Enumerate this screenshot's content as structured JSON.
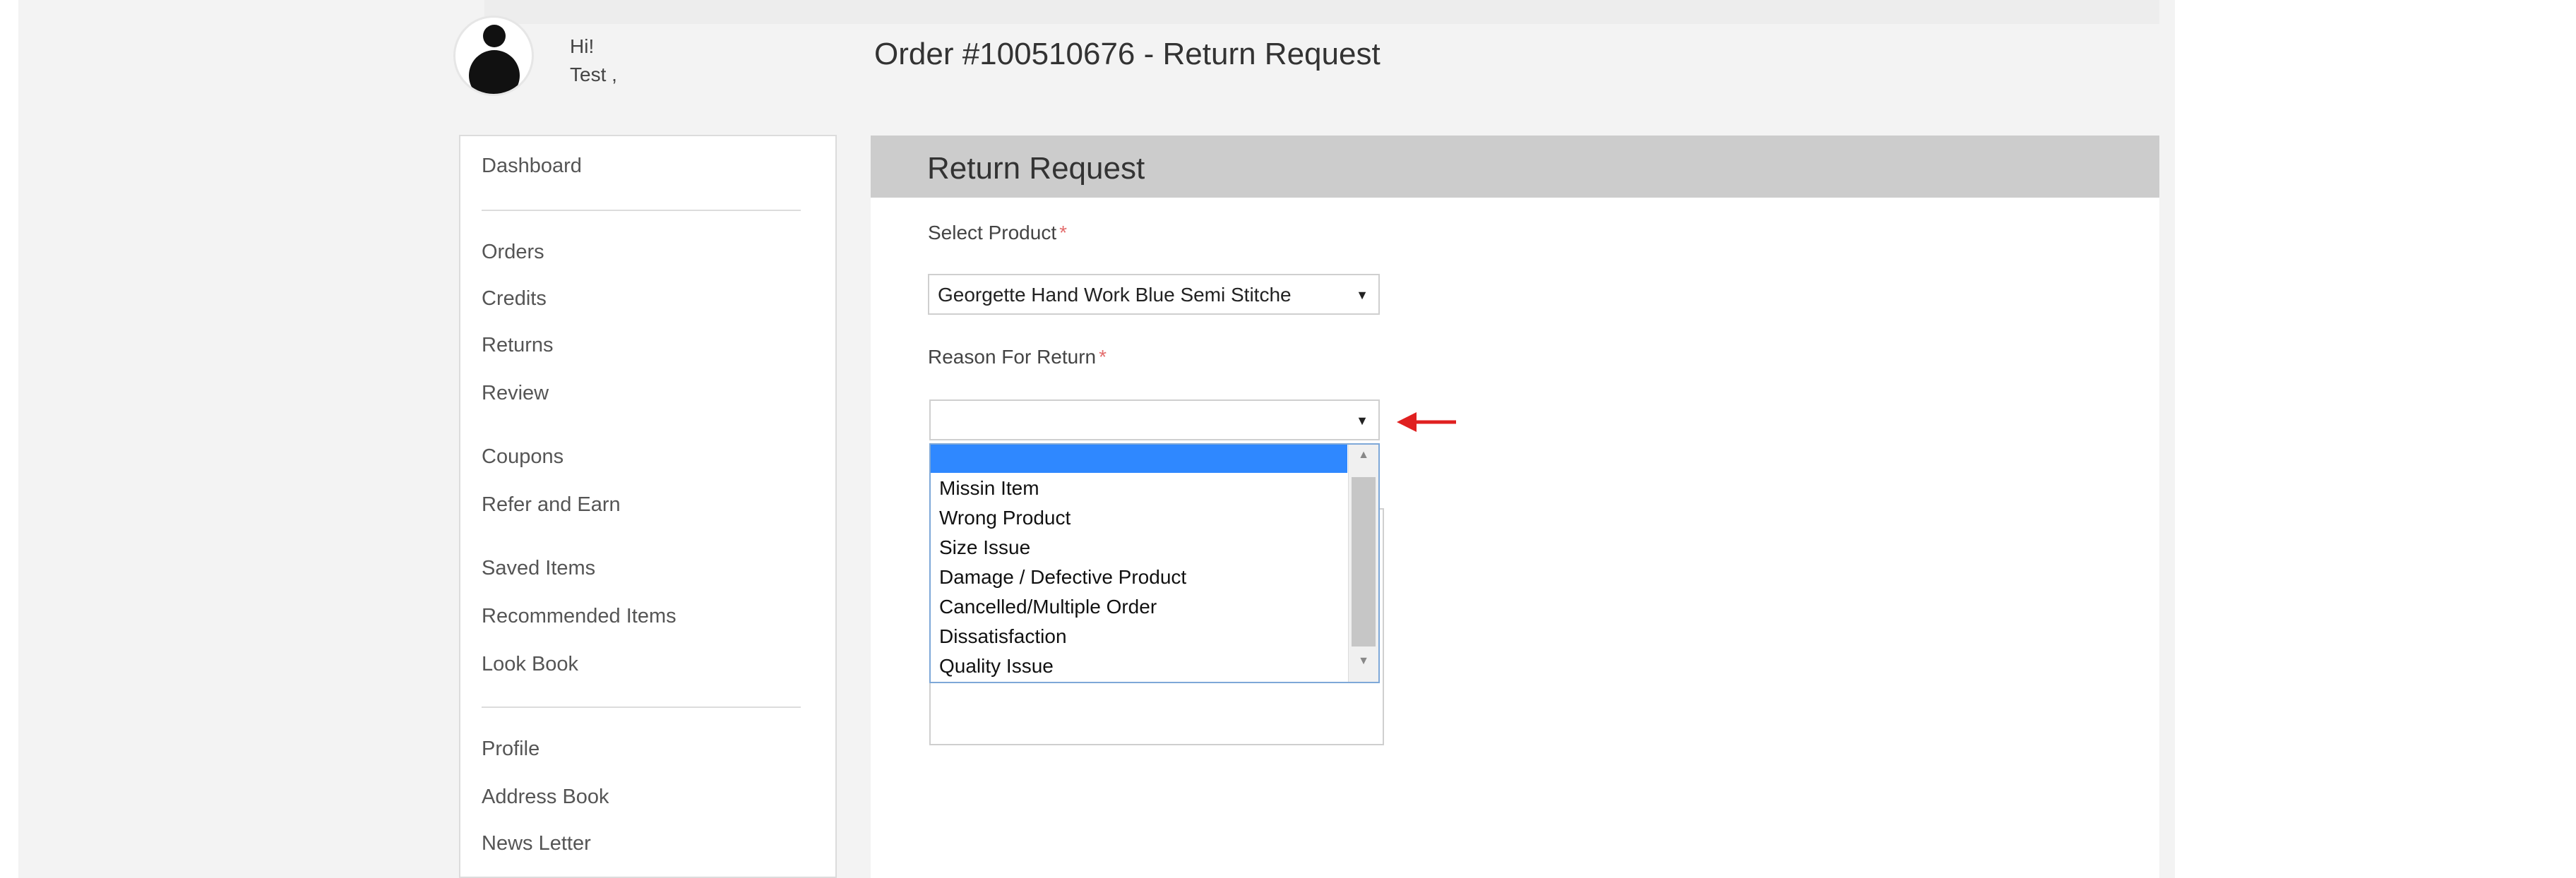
{
  "user": {
    "greeting": "Hi!",
    "name": "Test ,"
  },
  "page_title": "Order #100510676 - Return Request",
  "sidebar": {
    "items": [
      "Dashboard",
      "Orders",
      "Credits",
      "Returns",
      "Review",
      "Coupons",
      "Refer and Earn",
      "Saved Items",
      "Recommended Items",
      "Look Book",
      "Profile",
      "Address Book",
      "News Letter"
    ]
  },
  "main": {
    "header": "Return Request",
    "product_label": "Select Product",
    "product_value": "Georgette Hand Work Blue Semi Stitchе",
    "reason_label": "Reason For Return",
    "reason_value": "",
    "required_mark": "*",
    "reason_options": [
      "",
      "Missin Item",
      "Wrong Product",
      "Size Issue",
      "Damage / Defective Product",
      "Cancelled/Multiple Order",
      "Dissatisfaction",
      "Quality Issue"
    ]
  },
  "colors": {
    "accent_blue": "#2f88ff",
    "header_gray": "#cccccc",
    "annotation_arrow": "#e02020",
    "required": "#e36c6c"
  },
  "icons": {
    "avatar": "user-avatar-icon",
    "dropdown_caret": "triangle-down",
    "scroll_up": "triangle-up",
    "scroll_down": "triangle-down",
    "annotation": "left-arrow"
  }
}
